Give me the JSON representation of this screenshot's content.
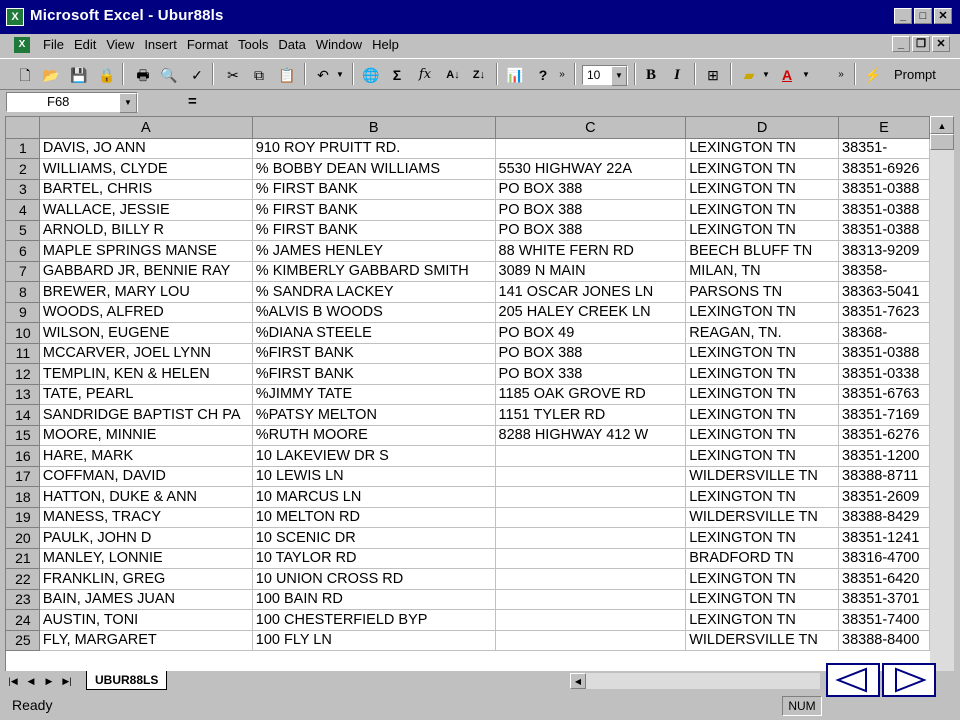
{
  "window": {
    "title": "Microsoft Excel - Ubur88ls",
    "app_icon": "X"
  },
  "menu": [
    "File",
    "Edit",
    "View",
    "Insert",
    "Format",
    "Tools",
    "Data",
    "Window",
    "Help"
  ],
  "toolbar": {
    "font_size": "10",
    "bold": "B",
    "italic": "I",
    "prompt": "Prompt",
    "sigma": "Σ",
    "fx": "fx"
  },
  "formula_bar": {
    "name_box": "F68",
    "equals": "=",
    "content": ""
  },
  "columns": [
    "A",
    "B",
    "C",
    "D",
    "E"
  ],
  "rows": [
    {
      "n": "1",
      "a": "DAVIS, JO ANN",
      "b": "910 ROY PRUITT RD.",
      "c": "",
      "d": "LEXINGTON TN",
      "e": "38351-"
    },
    {
      "n": "2",
      "a": "WILLIAMS, CLYDE",
      "b": "% BOBBY DEAN WILLIAMS",
      "c": "5530 HIGHWAY 22A",
      "d": "LEXINGTON TN",
      "e": "38351-6926"
    },
    {
      "n": "3",
      "a": "BARTEL, CHRIS",
      "b": "% FIRST BANK",
      "c": "PO BOX 388",
      "d": "LEXINGTON TN",
      "e": "38351-0388"
    },
    {
      "n": "4",
      "a": "WALLACE, JESSIE",
      "b": "% FIRST BANK",
      "c": "PO BOX 388",
      "d": "LEXINGTON TN",
      "e": "38351-0388"
    },
    {
      "n": "5",
      "a": "ARNOLD, BILLY R",
      "b": "% FIRST BANK",
      "c": "PO BOX 388",
      "d": "LEXINGTON TN",
      "e": "38351-0388"
    },
    {
      "n": "6",
      "a": "MAPLE SPRINGS MANSE",
      "b": "% JAMES HENLEY",
      "c": "88 WHITE FERN RD",
      "d": "BEECH BLUFF TN",
      "e": "38313-9209"
    },
    {
      "n": "7",
      "a": "GABBARD JR, BENNIE RAY",
      "b": "% KIMBERLY GABBARD SMITH",
      "c": "3089 N MAIN",
      "d": "MILAN, TN",
      "e": "38358-"
    },
    {
      "n": "8",
      "a": "BREWER, MARY LOU",
      "b": "% SANDRA LACKEY",
      "c": "141 OSCAR JONES LN",
      "d": "PARSONS TN",
      "e": "38363-5041"
    },
    {
      "n": "9",
      "a": "WOODS, ALFRED",
      "b": "%ALVIS B WOODS",
      "c": "205 HALEY CREEK LN",
      "d": "LEXINGTON TN",
      "e": "38351-7623"
    },
    {
      "n": "10",
      "a": "WILSON, EUGENE",
      "b": "%DIANA STEELE",
      "c": "PO BOX 49",
      "d": "REAGAN, TN.",
      "e": "38368-"
    },
    {
      "n": "11",
      "a": "MCCARVER, JOEL LYNN",
      "b": "%FIRST BANK",
      "c": "PO BOX 388",
      "d": "LEXINGTON TN",
      "e": "38351-0388"
    },
    {
      "n": "12",
      "a": "TEMPLIN, KEN & HELEN",
      "b": "%FIRST BANK",
      "c": "PO BOX 338",
      "d": "LEXINGTON TN",
      "e": "38351-0338"
    },
    {
      "n": "13",
      "a": "TATE, PEARL",
      "b": "%JIMMY TATE",
      "c": "1185 OAK GROVE RD",
      "d": "LEXINGTON TN",
      "e": "38351-6763"
    },
    {
      "n": "14",
      "a": "SANDRIDGE BAPTIST CH PA",
      "b": "%PATSY MELTON",
      "c": "1151 TYLER RD",
      "d": "LEXINGTON TN",
      "e": "38351-7169"
    },
    {
      "n": "15",
      "a": "MOORE, MINNIE",
      "b": "%RUTH MOORE",
      "c": "8288 HIGHWAY 412 W",
      "d": "LEXINGTON TN",
      "e": "38351-6276"
    },
    {
      "n": "16",
      "a": "HARE, MARK",
      "b": "10 LAKEVIEW DR S",
      "c": "",
      "d": "LEXINGTON TN",
      "e": "38351-1200"
    },
    {
      "n": "17",
      "a": "COFFMAN, DAVID",
      "b": "10 LEWIS LN",
      "c": "",
      "d": "WILDERSVILLE TN",
      "e": "38388-8711"
    },
    {
      "n": "18",
      "a": "HATTON, DUKE & ANN",
      "b": "10 MARCUS LN",
      "c": "",
      "d": "LEXINGTON TN",
      "e": "38351-2609"
    },
    {
      "n": "19",
      "a": "MANESS, TRACY",
      "b": "10 MELTON RD",
      "c": "",
      "d": "WILDERSVILLE TN",
      "e": "38388-8429"
    },
    {
      "n": "20",
      "a": "PAULK, JOHN D",
      "b": "10 SCENIC DR",
      "c": "",
      "d": "LEXINGTON TN",
      "e": "38351-1241"
    },
    {
      "n": "21",
      "a": "MANLEY, LONNIE",
      "b": "10 TAYLOR RD",
      "c": "",
      "d": "BRADFORD TN",
      "e": "38316-4700"
    },
    {
      "n": "22",
      "a": "FRANKLIN, GREG",
      "b": "10 UNION CROSS RD",
      "c": "",
      "d": "LEXINGTON TN",
      "e": "38351-6420"
    },
    {
      "n": "23",
      "a": "BAIN, JAMES JUAN",
      "b": "100 BAIN RD",
      "c": "",
      "d": "LEXINGTON TN",
      "e": "38351-3701"
    },
    {
      "n": "24",
      "a": "AUSTIN, TONI",
      "b": "100 CHESTERFIELD BYP",
      "c": "",
      "d": "LEXINGTON TN",
      "e": "38351-7400"
    },
    {
      "n": "25",
      "a": "FLY, MARGARET",
      "b": "100 FLY LN",
      "c": "",
      "d": "WILDERSVILLE TN",
      "e": "38388-8400"
    }
  ],
  "sheet_tab": "UBUR88LS",
  "status": {
    "ready": "Ready",
    "num": "NUM"
  }
}
